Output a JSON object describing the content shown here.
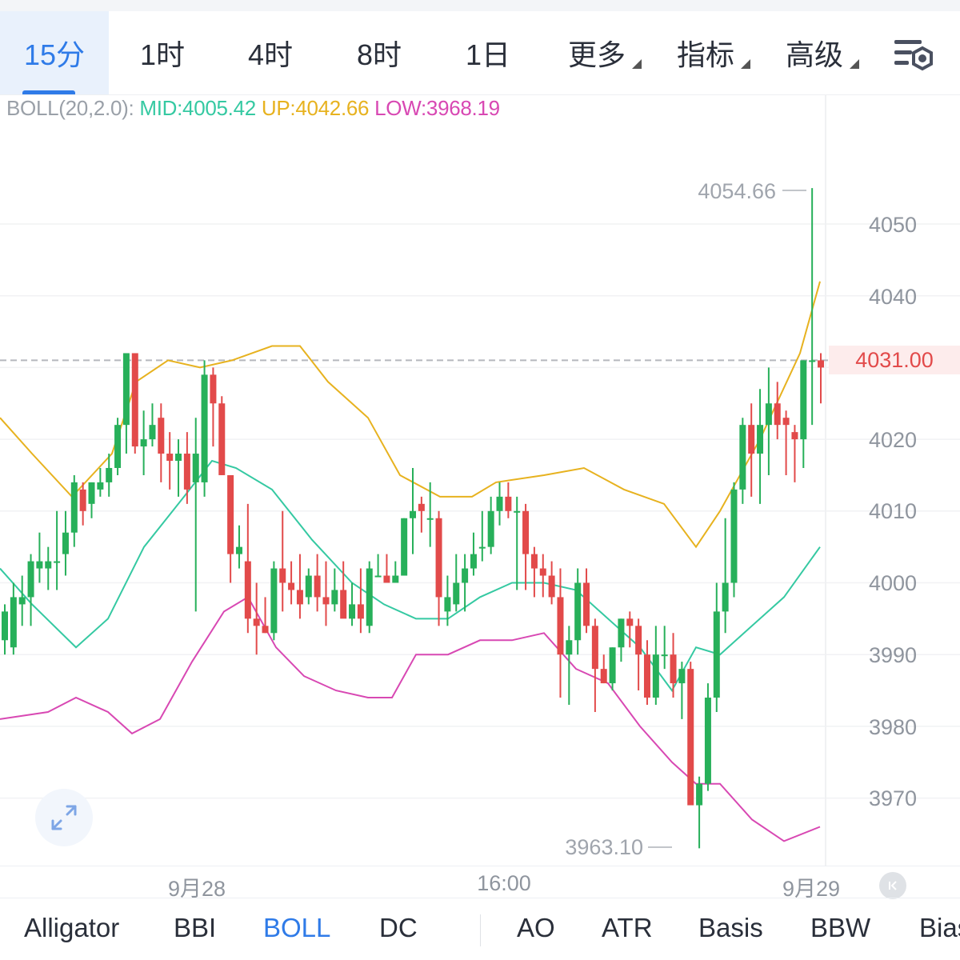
{
  "timeframe_tabs": [
    {
      "label": "15分",
      "active": true
    },
    {
      "label": "1时",
      "active": false
    },
    {
      "label": "4时",
      "active": false
    },
    {
      "label": "8时",
      "active": false
    },
    {
      "label": "1日",
      "active": false
    },
    {
      "label": "更多",
      "active": false,
      "dropdown": true
    },
    {
      "label": "指标",
      "active": false,
      "dropdown": true
    },
    {
      "label": "高级",
      "active": false,
      "dropdown": true
    }
  ],
  "boll_legend": {
    "label": "BOLL(20,2.0):",
    "mid": "MID:4005.42",
    "up": "UP:4042.66",
    "low": "LOW:3968.19"
  },
  "price_axis": {
    "ticks": [
      "4050",
      "4040",
      "4020",
      "4010",
      "4000",
      "3990",
      "3980",
      "3970"
    ],
    "current_price": "4031.00"
  },
  "annotations": {
    "high": "4054.66",
    "low": "3963.10"
  },
  "time_axis": [
    "9月28",
    "16:00",
    "9月29"
  ],
  "indicator_tabs": [
    {
      "label": "Alligator",
      "active": false
    },
    {
      "label": "BBI",
      "active": false
    },
    {
      "label": "BOLL",
      "active": true
    },
    {
      "label": "DC",
      "active": false
    },
    {
      "label": "AO",
      "active": false
    },
    {
      "label": "ATR",
      "active": false
    },
    {
      "label": "Basis",
      "active": false
    },
    {
      "label": "BBW",
      "active": false
    },
    {
      "label": "Bias",
      "active": false
    }
  ],
  "colors": {
    "up_candle": "#27b05a",
    "down_candle": "#e24a4a",
    "boll_mid": "#35c9a2",
    "boll_up": "#e7b21f",
    "boll_low": "#d848b3",
    "accent": "#2f7be8"
  },
  "chart_data": {
    "type": "candlestick",
    "title": "",
    "y_range": [
      3962,
      4058
    ],
    "ticks_y": [
      3970,
      3980,
      3990,
      4000,
      4010,
      4020,
      4030,
      4040,
      4050
    ],
    "current_price": 4031.0,
    "ohlc": [
      [
        3992,
        3997,
        3990,
        3996
      ],
      [
        3991,
        4000,
        3990,
        3998
      ],
      [
        3997,
        4001,
        3994,
        3998
      ],
      [
        3998,
        4004,
        3994,
        4003
      ],
      [
        4002,
        4007,
        4000,
        4003
      ],
      [
        4002,
        4005,
        3999,
        4003
      ],
      [
        4003,
        4010,
        3999,
        4003
      ],
      [
        4004,
        4010,
        4001,
        4007
      ],
      [
        4007,
        4015,
        4005,
        4014
      ],
      [
        4013,
        4014,
        4008,
        4010
      ],
      [
        4011,
        4014,
        4009,
        4014
      ],
      [
        4013,
        4016,
        4012,
        4014
      ],
      [
        4014,
        4018,
        4012,
        4016
      ],
      [
        4016,
        4023,
        4015,
        4022
      ],
      [
        4022,
        4032,
        4018,
        4032
      ],
      [
        4032,
        4032,
        4018,
        4019
      ],
      [
        4019,
        4024,
        4015,
        4020
      ],
      [
        4020,
        4025,
        4019,
        4022
      ],
      [
        4023,
        4025,
        4014,
        4018
      ],
      [
        4018,
        4021,
        4013,
        4017
      ],
      [
        4017,
        4020,
        4012,
        4018
      ],
      [
        4018,
        4021,
        4011,
        4013
      ],
      [
        4014,
        4023,
        3996,
        4018
      ],
      [
        4014,
        4031,
        4012,
        4029
      ],
      [
        4029,
        4030,
        4019,
        4025
      ],
      [
        4025,
        4026,
        4015,
        4015
      ],
      [
        4015,
        4015,
        4000,
        4004
      ],
      [
        4004,
        4008,
        4002,
        4005
      ],
      [
        4003,
        4011,
        3993,
        3995
      ],
      [
        3995,
        4000,
        3990,
        3994
      ],
      [
        3994,
        3998,
        3993,
        3993
      ],
      [
        3993,
        4003,
        3992,
        4002
      ],
      [
        4002,
        4010,
        3996,
        4000
      ],
      [
        4000,
        4003,
        3997,
        3999
      ],
      [
        3999,
        4004,
        3995,
        3997
      ],
      [
        3998,
        4002,
        3997,
        4001
      ],
      [
        4001,
        4004,
        3996,
        3998
      ],
      [
        3998,
        4003,
        3994,
        3997
      ],
      [
        3997,
        4002,
        3996,
        3999
      ],
      [
        3999,
        4003,
        3996,
        3995
      ],
      [
        3995,
        4000,
        3994,
        3997
      ],
      [
        3997,
        4002,
        3993,
        3995
      ],
      [
        3994,
        4003,
        3993,
        4002
      ],
      [
        4001,
        4004,
        4001,
        4001
      ],
      [
        4001,
        4004,
        4001,
        4000
      ],
      [
        4000,
        4003,
        4000,
        4001
      ],
      [
        4001,
        4009,
        4001,
        4009
      ],
      [
        4009,
        4016,
        4004,
        4010
      ],
      [
        4011,
        4012,
        4007,
        4010
      ],
      [
        4009,
        4014,
        4005,
        4009
      ],
      [
        4009,
        4010,
        3994,
        3998
      ],
      [
        3996,
        4001,
        3994,
        3998
      ],
      [
        3997,
        4004,
        3996,
        4000
      ],
      [
        4000,
        4004,
        3996,
        4002
      ],
      [
        4002,
        4007,
        4001,
        4004
      ],
      [
        4005,
        4010,
        4003,
        4005
      ],
      [
        4005,
        4012,
        4004,
        4010
      ],
      [
        4010,
        4014,
        4008,
        4012
      ],
      [
        4012,
        4014,
        4009,
        4010
      ],
      [
        4010,
        4012,
        3999,
        4010
      ],
      [
        4010,
        4011,
        3999,
        4004
      ],
      [
        4004,
        4005,
        3998,
        4002
      ],
      [
        4002,
        4004,
        3998,
        4001
      ],
      [
        4001,
        4003,
        3997,
        3998
      ],
      [
        3998,
        4002,
        3984,
        3990
      ],
      [
        3990,
        3994,
        3983,
        3992
      ],
      [
        3992,
        4002,
        3990,
        4000
      ],
      [
        4000,
        4002,
        3993,
        3994
      ],
      [
        3994,
        3995,
        3982,
        3988
      ],
      [
        3988,
        3990,
        3986,
        3986
      ],
      [
        3986,
        3991,
        3985,
        3991
      ],
      [
        3991,
        3995,
        3989,
        3995
      ],
      [
        3995,
        3996,
        3991,
        3994
      ],
      [
        3994,
        3995,
        3985,
        3990
      ],
      [
        3990,
        3992,
        3983,
        3984
      ],
      [
        3984,
        3994,
        3983,
        3990
      ],
      [
        3990,
        3994,
        3988,
        3990
      ],
      [
        3990,
        3993,
        3984,
        3986
      ],
      [
        3986,
        3989,
        3981,
        3988
      ],
      [
        3988,
        3989,
        3978,
        3969
      ],
      [
        3969,
        3973,
        3963,
        3972
      ],
      [
        3972,
        3986,
        3971,
        3984
      ],
      [
        3984,
        4000,
        3982,
        3996
      ],
      [
        3996,
        4009,
        3993,
        4000
      ],
      [
        4000,
        4014,
        3998,
        4013
      ],
      [
        4013,
        4023,
        4011,
        4022
      ],
      [
        4022,
        4025,
        4012,
        4018
      ],
      [
        4018,
        4027,
        4011,
        4022
      ],
      [
        4022,
        4030,
        4015,
        4025
      ],
      [
        4025,
        4028,
        4020,
        4022
      ],
      [
        4023,
        4024,
        4015,
        4022
      ],
      [
        4021,
        4022,
        4014,
        4020
      ],
      [
        4020,
        4031,
        4016,
        4031
      ],
      [
        4031,
        4055,
        4022,
        4031
      ],
      [
        4031,
        4032,
        4025,
        4030
      ]
    ],
    "boll_mid": [
      [
        0,
        4002
      ],
      [
        40,
        3997
      ],
      [
        95,
        3991
      ],
      [
        135,
        3995
      ],
      [
        180,
        4005
      ],
      [
        230,
        4012
      ],
      [
        265,
        4017
      ],
      [
        295,
        4016
      ],
      [
        340,
        4013
      ],
      [
        390,
        4006
      ],
      [
        440,
        4000
      ],
      [
        480,
        3997
      ],
      [
        520,
        3995
      ],
      [
        560,
        3995
      ],
      [
        600,
        3998
      ],
      [
        640,
        4000
      ],
      [
        680,
        4000
      ],
      [
        720,
        3999
      ],
      [
        760,
        3995
      ],
      [
        800,
        3991
      ],
      [
        840,
        3985
      ],
      [
        870,
        3991
      ],
      [
        900,
        3990
      ],
      [
        940,
        3994
      ],
      [
        980,
        3998
      ],
      [
        1025,
        4005
      ]
    ],
    "boll_up": [
      [
        0,
        4023
      ],
      [
        40,
        4018
      ],
      [
        90,
        4012
      ],
      [
        140,
        4018
      ],
      [
        170,
        4028
      ],
      [
        210,
        4031
      ],
      [
        250,
        4030
      ],
      [
        290,
        4031
      ],
      [
        340,
        4033
      ],
      [
        375,
        4033
      ],
      [
        410,
        4028
      ],
      [
        460,
        4023
      ],
      [
        500,
        4015
      ],
      [
        550,
        4012
      ],
      [
        590,
        4012
      ],
      [
        620,
        4014
      ],
      [
        680,
        4015
      ],
      [
        730,
        4016
      ],
      [
        780,
        4013
      ],
      [
        830,
        4011
      ],
      [
        870,
        4005
      ],
      [
        900,
        4010
      ],
      [
        950,
        4020
      ],
      [
        975,
        4026
      ],
      [
        1000,
        4032
      ],
      [
        1025,
        4042
      ]
    ],
    "boll_low": [
      [
        0,
        3981
      ],
      [
        60,
        3982
      ],
      [
        95,
        3984
      ],
      [
        135,
        3982
      ],
      [
        165,
        3979
      ],
      [
        200,
        3981
      ],
      [
        240,
        3989
      ],
      [
        280,
        3996
      ],
      [
        310,
        3998
      ],
      [
        345,
        3991
      ],
      [
        380,
        3987
      ],
      [
        420,
        3985
      ],
      [
        460,
        3984
      ],
      [
        490,
        3984
      ],
      [
        520,
        3990
      ],
      [
        560,
        3990
      ],
      [
        600,
        3992
      ],
      [
        640,
        3992
      ],
      [
        680,
        3993
      ],
      [
        720,
        3988
      ],
      [
        760,
        3986
      ],
      [
        800,
        3980
      ],
      [
        840,
        3975
      ],
      [
        870,
        3972
      ],
      [
        900,
        3972
      ],
      [
        940,
        3967
      ],
      [
        980,
        3964
      ],
      [
        1025,
        3966
      ]
    ]
  }
}
